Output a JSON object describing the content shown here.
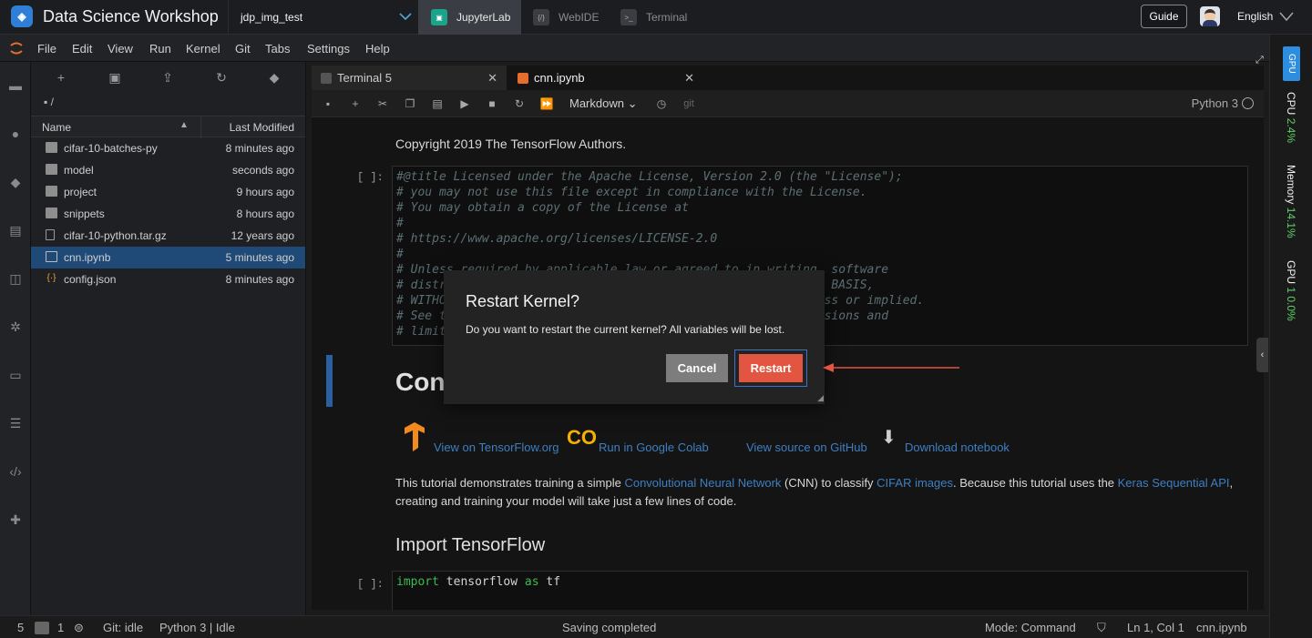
{
  "topbar": {
    "title": "Data Science Workshop",
    "workspace": "jdp_img_test",
    "tabs": [
      {
        "label": "JupyterLab",
        "active": true
      },
      {
        "label": "WebIDE",
        "active": false
      },
      {
        "label": "Terminal",
        "active": false
      }
    ],
    "guide": "Guide",
    "language": "English"
  },
  "menu": [
    "File",
    "Edit",
    "View",
    "Run",
    "Kernel",
    "Git",
    "Tabs",
    "Settings",
    "Help"
  ],
  "filebrowser": {
    "path": "/",
    "col_name": "Name",
    "col_modified": "Last Modified",
    "files": [
      {
        "name": "cifar-10-batches-py",
        "modified": "8 minutes ago",
        "kind": "folder"
      },
      {
        "name": "model",
        "modified": "seconds ago",
        "kind": "folder"
      },
      {
        "name": "project",
        "modified": "9 hours ago",
        "kind": "folder"
      },
      {
        "name": "snippets",
        "modified": "8 hours ago",
        "kind": "folder"
      },
      {
        "name": "cifar-10-python.tar.gz",
        "modified": "12 years ago",
        "kind": "file"
      },
      {
        "name": "cnn.ipynb",
        "modified": "5 minutes ago",
        "kind": "notebook",
        "selected": true
      },
      {
        "name": "config.json",
        "modified": "8 minutes ago",
        "kind": "json"
      }
    ]
  },
  "doc_tabs": [
    {
      "label": "Terminal 5",
      "active": false
    },
    {
      "label": "cnn.ipynb",
      "active": true
    }
  ],
  "notebook": {
    "cell_type": "Markdown",
    "kernel": "Python 3",
    "git_label": "git",
    "copyright": "Copyright 2019 The TensorFlow Authors.",
    "prompt": "[ ]:",
    "license_lines": [
      "#@title Licensed under the Apache License, Version 2.0 (the \"License\");",
      "# you may not use this file except in compliance with the License.",
      "# You may obtain a copy of the License at",
      "#",
      "# https://www.apache.org/licenses/LICENSE-2.0",
      "#",
      "# Unless required by applicable law or agreed to in writing, software",
      "# distributed under the License is distributed on an \"AS IS\" BASIS,",
      "# WITHOUT WARRANTIES OR CONDITIONS OF ANY KIND, either express or implied.",
      "# See the License for the specific language governing permissions and",
      "# limitations under the License."
    ],
    "heading_partial": "Con",
    "links": {
      "tf": "View on TensorFlow.org",
      "colab": "Run in Google Colab",
      "github": "View source on GitHub",
      "download": "Download notebook"
    },
    "intro": {
      "t1": "This tutorial demonstrates training a simple ",
      "l1": "Convolutional Neural Network",
      "t2": " (CNN) to classify ",
      "l2": "CIFAR images",
      "t3": ". Because this tutorial uses the ",
      "l3": "Keras Sequential API",
      "t4": ",",
      "line2": "creating and training your model will take just a few lines of code."
    },
    "import_heading": "Import TensorFlow",
    "import_code": {
      "kw1": "import",
      "mod": " tensorflow ",
      "kw2": "as",
      "alias": " tf"
    }
  },
  "dialog": {
    "title": "Restart Kernel?",
    "body": "Do you want to restart the current kernel? All variables will be lost.",
    "cancel": "Cancel",
    "restart": "Restart"
  },
  "right_sidebar": {
    "badge": "GPU",
    "cpu_label": "CPU",
    "cpu_value": "2.4%",
    "mem_label": "Memory",
    "mem_value": "14.1%",
    "gpu_label": "GPU",
    "gpu_value": "1 0.0%"
  },
  "status": {
    "count1": "5",
    "count2": "1",
    "git": "Git: idle",
    "kernel": "Python 3 | Idle",
    "saving": "Saving completed",
    "mode": "Mode: Command",
    "position": "Ln 1, Col 1",
    "file": "cnn.ipynb"
  },
  "colors": {
    "accent": "#2f7fd7",
    "restart": "#e25540",
    "selection": "#1f4a77",
    "gauge": "#5fcf6a"
  }
}
